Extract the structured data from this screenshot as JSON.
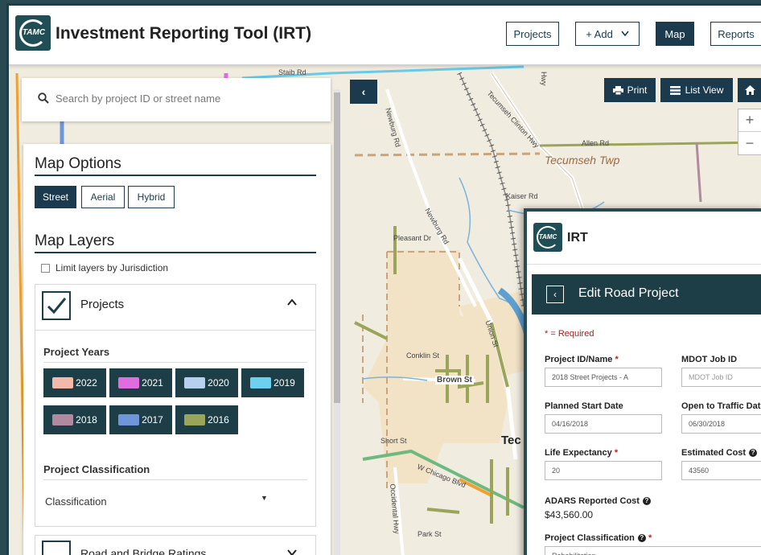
{
  "header": {
    "logo_text": "TAMC",
    "title": "Investment Reporting Tool (IRT)",
    "nav": {
      "projects": "Projects",
      "add": "+ Add",
      "map": "Map",
      "reports": "Reports"
    }
  },
  "search": {
    "placeholder": "Search by project ID or street name"
  },
  "map_options": {
    "title": "Map Options",
    "types": [
      "Street",
      "Aerial",
      "Hybrid"
    ],
    "active": "Street"
  },
  "map_layers": {
    "title": "Map Layers",
    "limit_label": "Limit layers by Jurisdiction",
    "projects_label": "Projects",
    "project_years_label": "Project Years",
    "years": [
      {
        "label": "2022",
        "color": "#f4b9a8"
      },
      {
        "label": "2021",
        "color": "#e06de0"
      },
      {
        "label": "2020",
        "color": "#b8d0f0"
      },
      {
        "label": "2019",
        "color": "#6ed0f0"
      },
      {
        "label": "2018",
        "color": "#b08aa0"
      },
      {
        "label": "2017",
        "color": "#6f96d8"
      },
      {
        "label": "2016",
        "color": "#9aa55a"
      }
    ],
    "classification_heading": "Project Classification",
    "classification_value": "Classification",
    "road_ratings_label": "Road and Bridge Ratings"
  },
  "map_controls": {
    "print": "Print",
    "list_view": "List View",
    "zoom_in": "+",
    "zoom_out": "−"
  },
  "map_labels": {
    "staib": "Staib Rd",
    "tecumseh_clinton": "Tecumseh Clinton Hwy",
    "allen": "Allen Rd",
    "tecumseh_twp": "Tecumseh Twp",
    "kaiser": "Kaiser Rd",
    "newburg1": "Newburg Rd",
    "newburg2": "Newburg Rd",
    "pleasant": "Pleasant Dr",
    "union": "Union St",
    "conklin": "Conklin St",
    "brown": "Brown St",
    "short": "Short St",
    "chicago": "W Chicago Blvd",
    "occidental": "Occidental Hwy",
    "park": "Park St",
    "tecumseh": "Tec",
    "hwy": "Hwy"
  },
  "edit_form": {
    "app_title": "IRT",
    "title": "Edit Road Project",
    "required_note": "* = Required",
    "project_id_label": "Project ID/Name",
    "project_id_value": "2018 Street Projects - A",
    "mdot_label": "MDOT Job ID",
    "mdot_placeholder": "MDOT Job ID",
    "start_label": "Planned Start Date",
    "start_value": "04/16/2018",
    "open_label": "Open to Traffic Date",
    "open_value": "06/30/2018",
    "life_label": "Life Expectancy",
    "life_value": "20",
    "cost_label": "Estimated Cost",
    "cost_value": "43560",
    "adars_label": "ADARS Reported Cost",
    "adars_value": "$43,560.00",
    "class_label": "Project Classification",
    "class_value": "Rehabilitation"
  },
  "colors": {
    "primary": "#1b3a4e",
    "map_bg": "#f1ece0",
    "required": "#c02020"
  }
}
